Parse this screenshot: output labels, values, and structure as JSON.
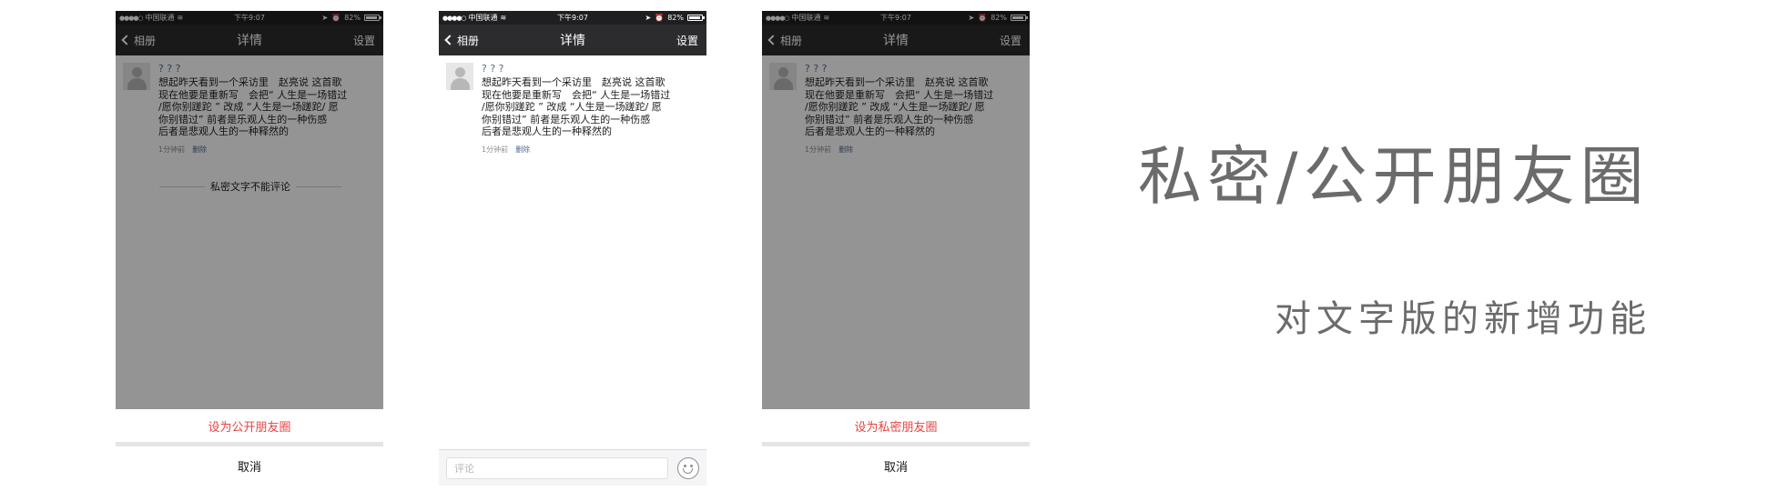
{
  "status_bar": {
    "carrier": "中国联通",
    "time": "下午9:07",
    "battery": "82%"
  },
  "nav": {
    "back_label": "相册",
    "title": "详情",
    "settings_label": "设置"
  },
  "post": {
    "author": "? ? ?",
    "text": "想起昨天看到一个采访里　赵亮说  这首歌\n现在他要是重新写　会把“ 人生是一场错过\n /愿你别蹉跎 ” 改成  “人生是一场蹉跎/  愿\n你别错过”  前者是乐观人生的一种伤感\n后者是悲观人生的一种释然的",
    "time": "1分钟前",
    "delete_label": "删除"
  },
  "screens": [
    {
      "private_notice": "私密文字不能评论",
      "action_label": "设为公开朋友圈",
      "cancel_label": "取消"
    },
    {
      "comment_placeholder": "评论"
    },
    {
      "action_label": "设为私密朋友圈",
      "cancel_label": "取消"
    }
  ],
  "headline": "私密/公开朋友圈",
  "subline": "对文字版的新增功能",
  "colors": {
    "nav_bg": "#2c2c2e",
    "action_red": "#e64340",
    "link_blue": "#566a93",
    "headline_gray": "#6b6b6b"
  }
}
